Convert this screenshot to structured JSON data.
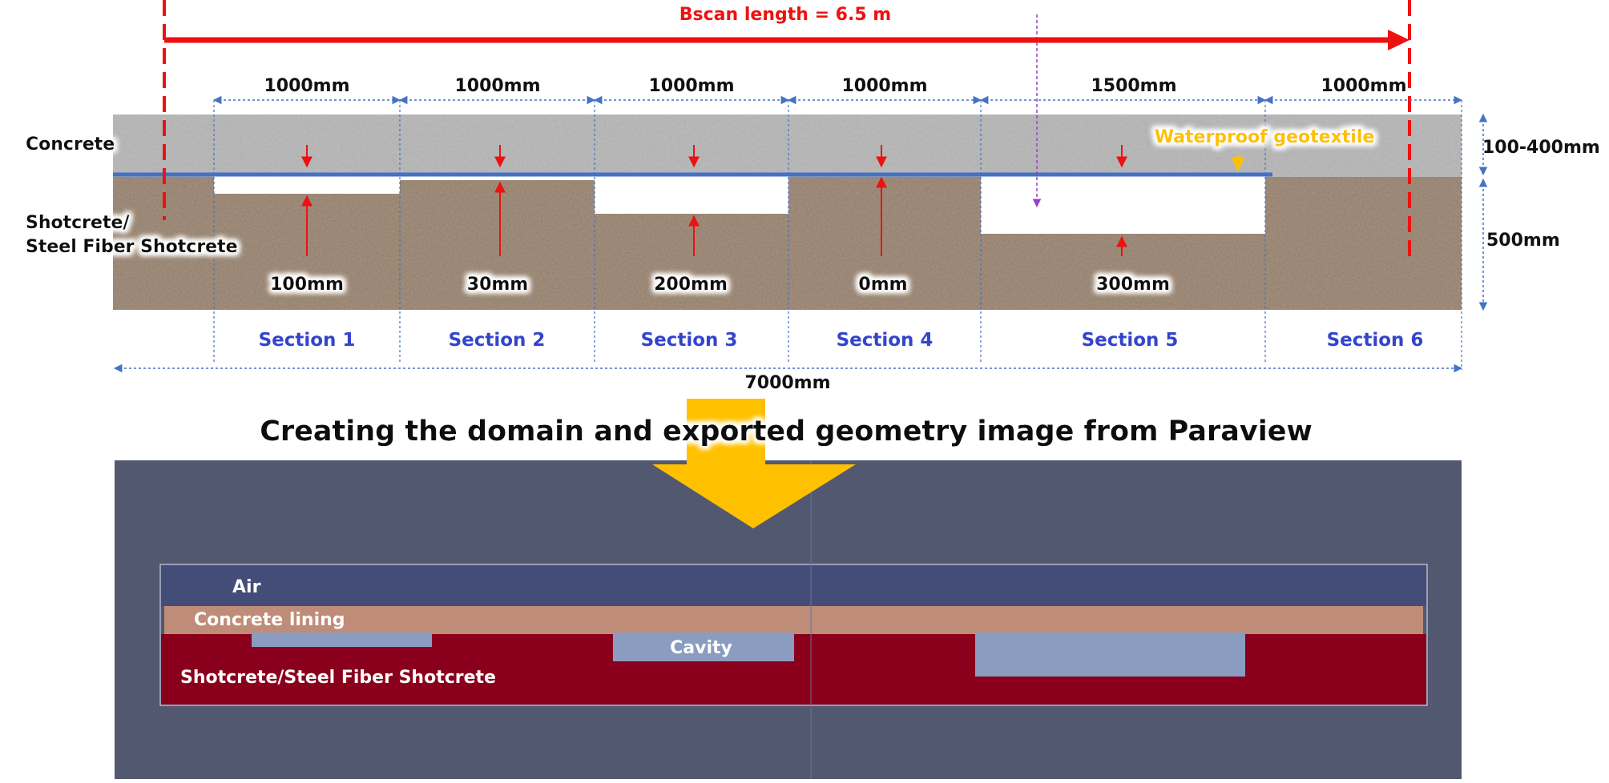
{
  "top": {
    "bscan_label": "Bscan length = 6.5 m",
    "section_widths": [
      "1000mm",
      "1000mm",
      "1000mm",
      "1000mm",
      "1500mm",
      "1000mm"
    ],
    "cavity_labels": [
      "100mm",
      "30mm",
      "200mm",
      "0mm",
      "300mm"
    ],
    "section_labels": [
      "Section 1",
      "Section 2",
      "Section 3",
      "Section 4",
      "Section 5",
      "Section 6"
    ],
    "total_width": "7000mm",
    "concrete_label": "Concrete",
    "shotcrete_label_1": "Shotcrete/",
    "shotcrete_label_2": "Steel Fiber Shotcrete",
    "waterproof_label": "Waterproof geotextile",
    "concrete_thickness": "100-400mm",
    "shotcrete_thickness": "500mm"
  },
  "transition": {
    "caption": "Creating the domain and exported geometry image from Paraview"
  },
  "bottom": {
    "air_label": "Air",
    "concrete_lining_label": "Concrete lining",
    "cavity_label": "Cavity",
    "shotcrete_label": "Shotcrete/Steel Fiber Shotcrete"
  },
  "colors": {
    "bscan_red": "#ee1111",
    "dimension_blue": "#4472c4",
    "section_text": "#3344cc",
    "waterproof_yellow": "#ffc000",
    "geotextile_line": "#4472c4",
    "paraview_bg": "#525870",
    "air": "#444d78",
    "concrete_lining": "#bf8c78",
    "cavity": "#8a9cc0",
    "shotcrete": "#8a001c",
    "arrow_yellow": "#ffc000",
    "probe_purple": "#9b3fc4"
  }
}
